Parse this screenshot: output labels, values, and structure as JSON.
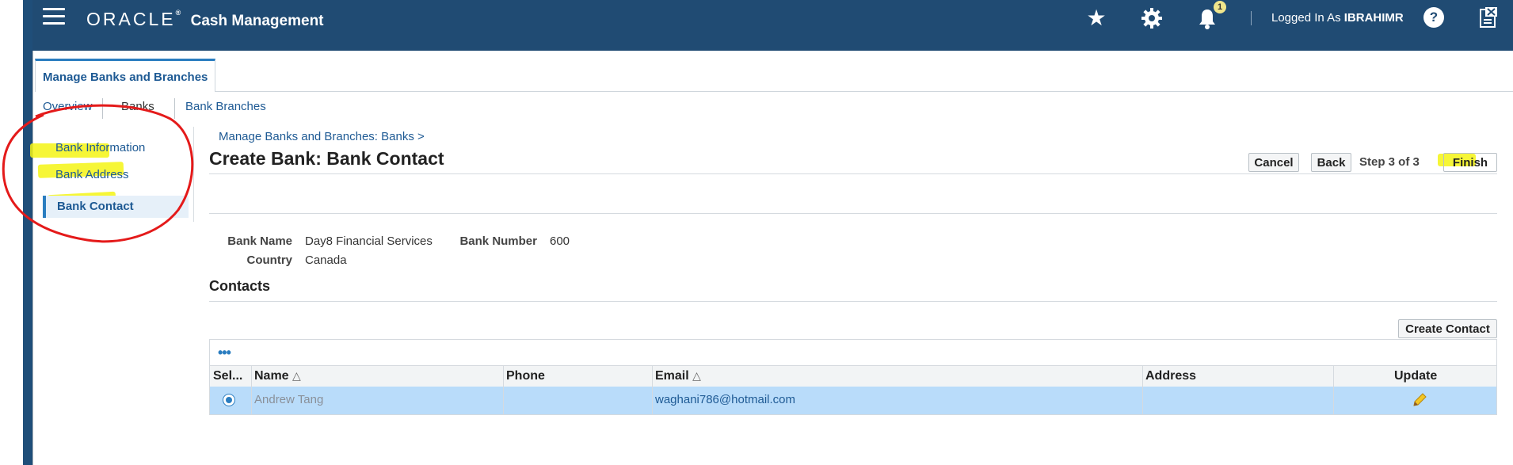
{
  "header": {
    "brand": "ORACLE",
    "app_name": "Cash Management",
    "notification_count": "1",
    "logged_in_prefix": "Logged In As",
    "username": "IBRAHIMR",
    "help_label": "?"
  },
  "tabs": {
    "main": "Manage Banks and Branches"
  },
  "subtabs": [
    "Overview",
    "Banks",
    "Bank Branches"
  ],
  "train": {
    "items": [
      "Bank Information",
      "Bank Address"
    ],
    "active": "Bank Contact"
  },
  "page": {
    "breadcrumb": "Manage Banks and Branches: Banks  >",
    "title": "Create Bank: Bank Contact",
    "buttons": {
      "cancel": "Cancel",
      "back": "Back",
      "finish": "Finish"
    },
    "step": "Step 3 of 3"
  },
  "bank": {
    "name_label": "Bank Name",
    "name": "Day8 Financial Services",
    "number_label": "Bank Number",
    "number": "600",
    "country_label": "Country",
    "country": "Canada"
  },
  "contacts": {
    "title": "Contacts",
    "create_button": "Create Contact",
    "actions_icon": "•••",
    "columns": [
      "Sel...",
      "Name",
      "Phone",
      "Email",
      "Address",
      "Update"
    ],
    "sort_indicator": "△",
    "rows": [
      {
        "name": "Andrew Tang",
        "phone": "",
        "email": "waghani786@hotmail.com",
        "address": ""
      }
    ]
  },
  "colors": {
    "header": "#204b73",
    "link": "#1e5a94",
    "selected_row": "#b9dcfa",
    "highlight": "#f5f514",
    "annotation": "#e41a1a"
  }
}
